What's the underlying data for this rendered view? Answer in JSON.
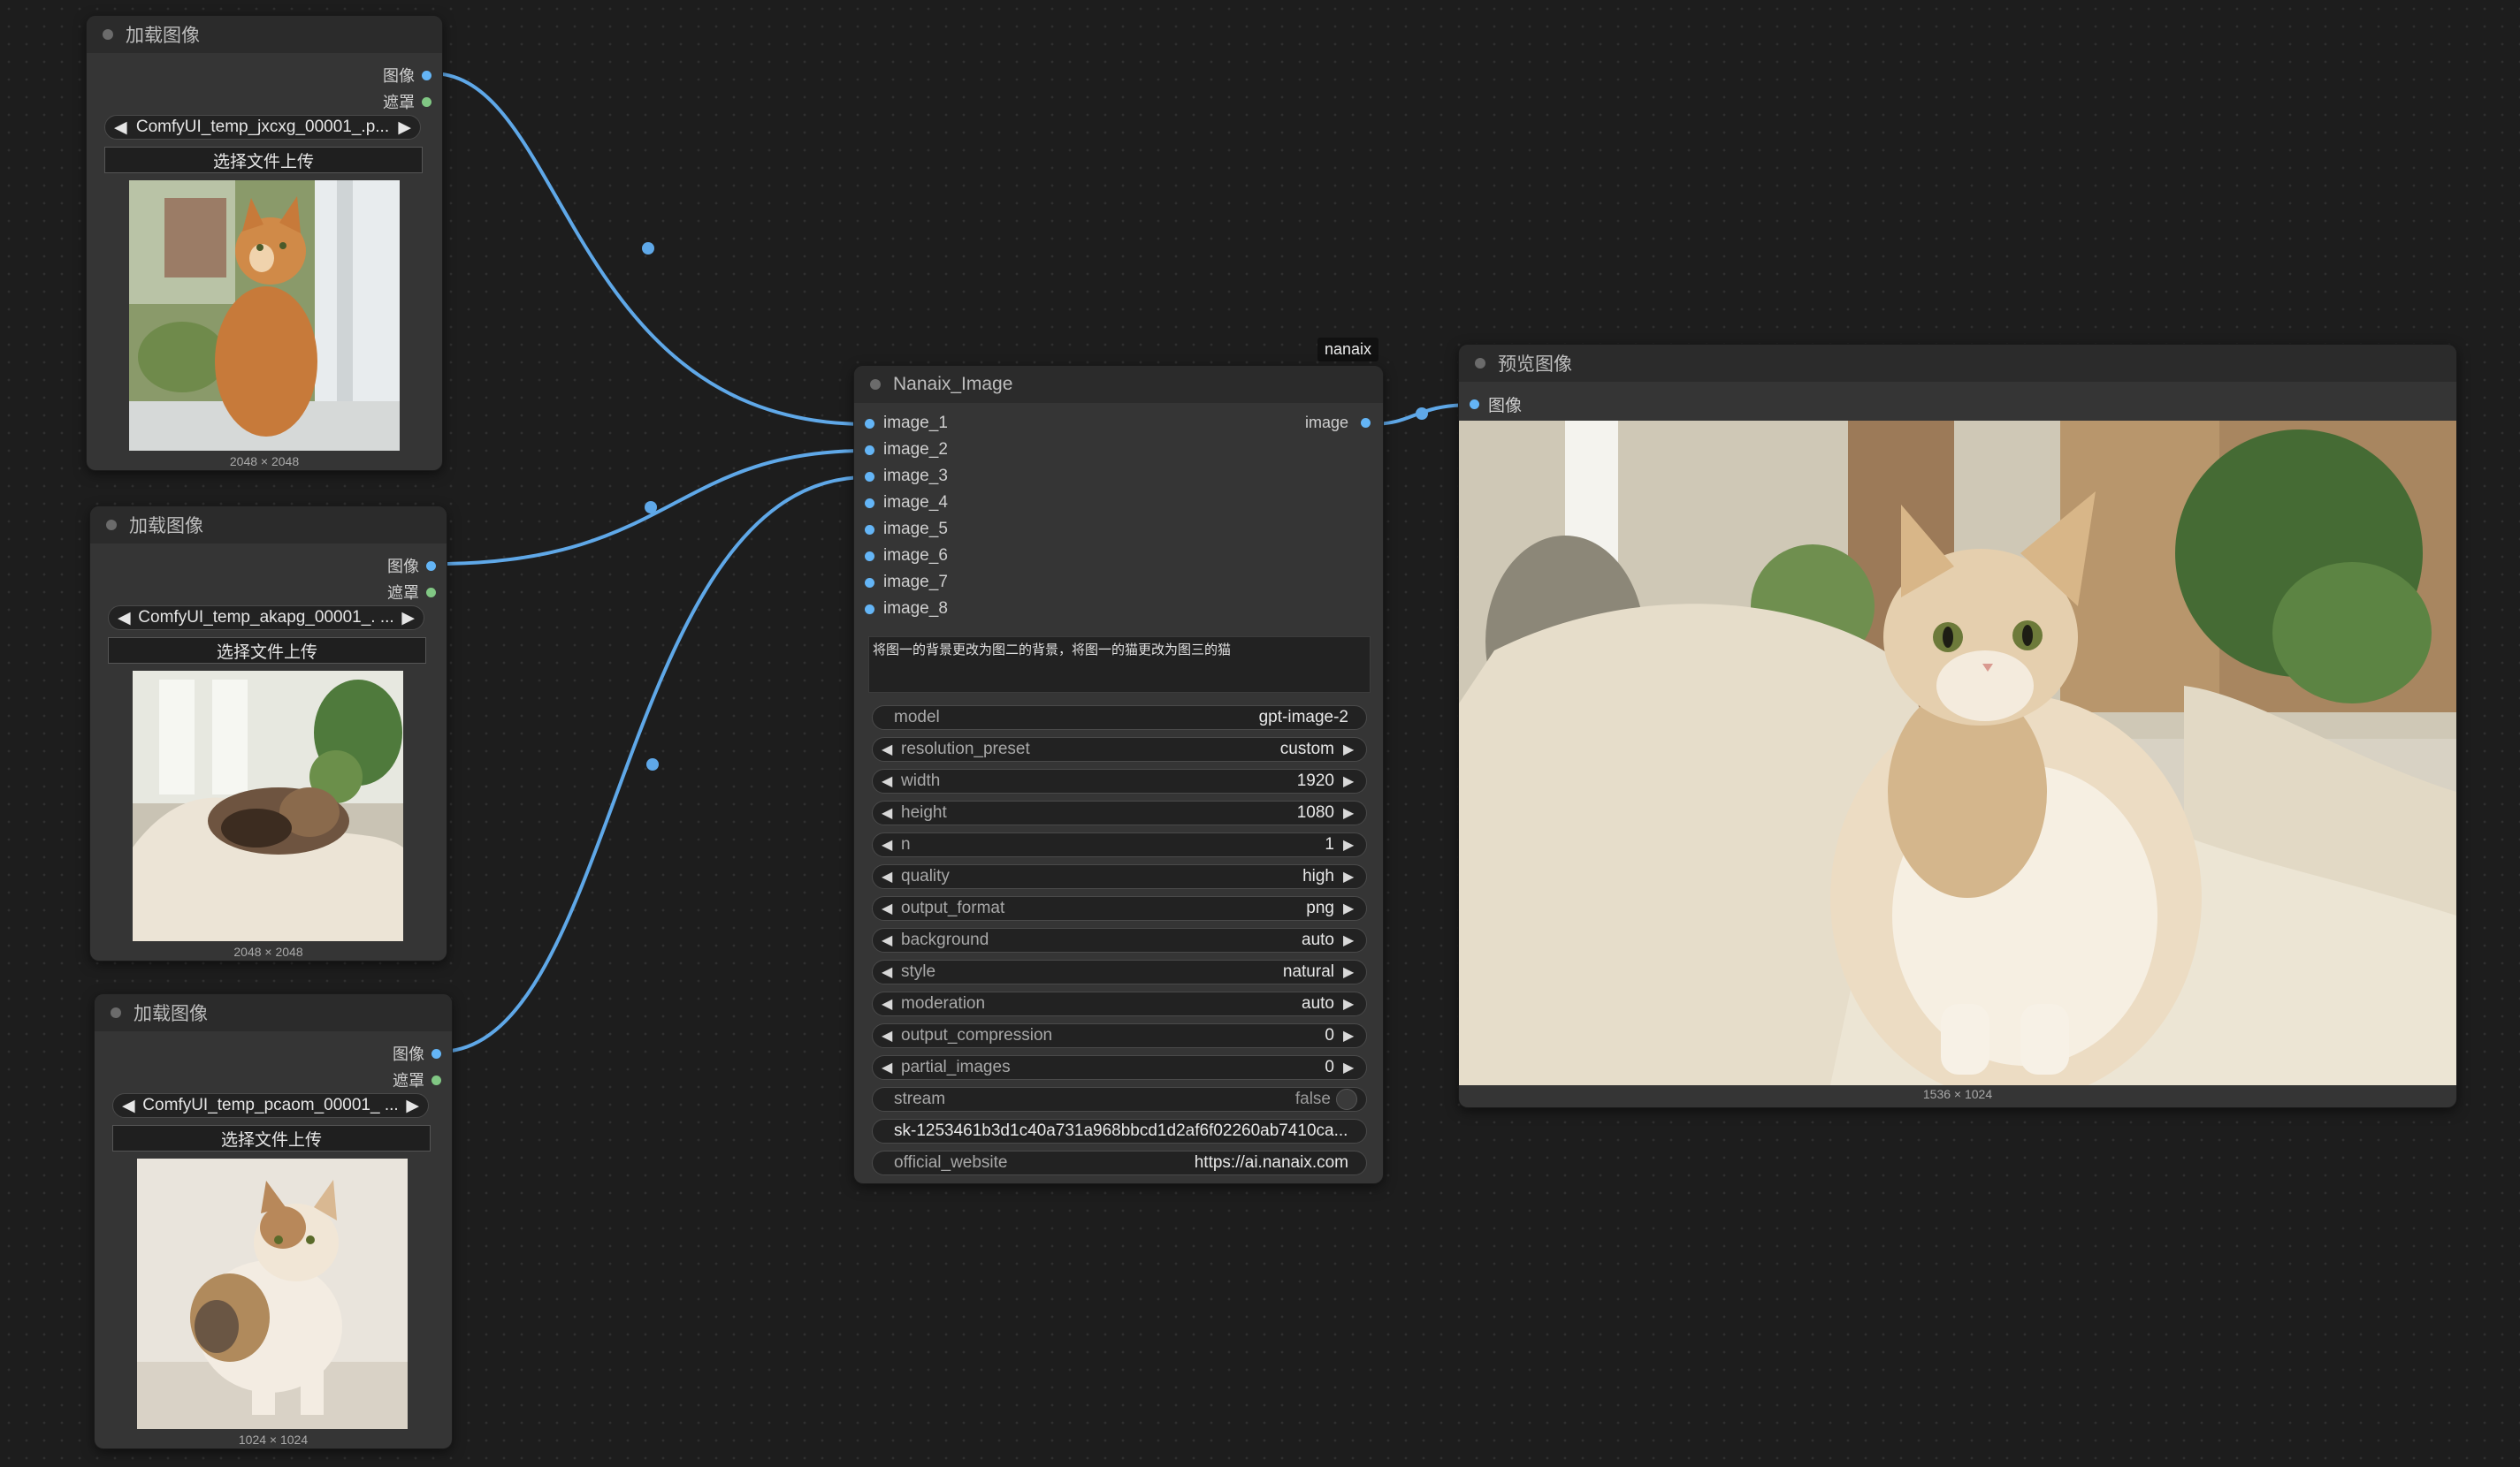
{
  "load_nodes": [
    {
      "title": "加载图像",
      "out_image": "图像",
      "out_mask": "遮罩",
      "file": "ComfyUI_temp_jxcxg_00001_.p...",
      "upload": "选择文件上传",
      "dims": "2048 × 2048"
    },
    {
      "title": "加载图像",
      "out_image": "图像",
      "out_mask": "遮罩",
      "file": "ComfyUI_temp_akapg_00001_. ...",
      "upload": "选择文件上传",
      "dims": "2048 × 2048"
    },
    {
      "title": "加载图像",
      "out_image": "图像",
      "out_mask": "遮罩",
      "file": "ComfyUI_temp_pcaom_00001_ ...",
      "upload": "选择文件上传",
      "dims": "1024 × 1024"
    }
  ],
  "nanaix": {
    "badge": "nanaix",
    "title": "Nanaix_Image",
    "output": "image",
    "inputs": [
      "image_1",
      "image_2",
      "image_3",
      "image_4",
      "image_5",
      "image_6",
      "image_7",
      "image_8"
    ],
    "prompt": "将图一的背景更改为图二的背景，将图一的猫更改为图三的猫",
    "widgets": [
      {
        "name": "model",
        "value": "gpt-image-2"
      },
      {
        "name": "resolution_preset",
        "value": "custom"
      },
      {
        "name": "width",
        "value": "1920"
      },
      {
        "name": "height",
        "value": "1080"
      },
      {
        "name": "n",
        "value": "1"
      },
      {
        "name": "quality",
        "value": "high"
      },
      {
        "name": "output_format",
        "value": "png"
      },
      {
        "name": "background",
        "value": "auto"
      },
      {
        "name": "style",
        "value": "natural"
      },
      {
        "name": "moderation",
        "value": "auto"
      },
      {
        "name": "output_compression",
        "value": "0"
      },
      {
        "name": "partial_images",
        "value": "0"
      },
      {
        "name": "stream",
        "value": "false"
      }
    ],
    "api_key": "sk-1253461b3d1c40a731a968bbcd1d2af6f02260ab7410ca...",
    "website_label": "official_website",
    "website_value": "https://ai.nanaix.com"
  },
  "preview": {
    "title": "预览图像",
    "in_label": "图像",
    "dims": "1536 × 1024"
  },
  "colors": {
    "image_socket": "#64b5f6",
    "mask_socket": "#81c784",
    "wire": "#5fa8e8"
  }
}
